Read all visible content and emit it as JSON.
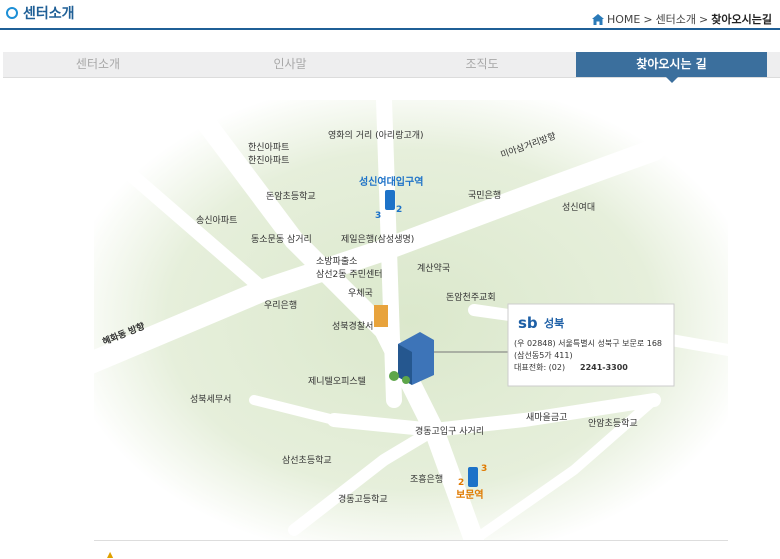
{
  "header": {
    "title": "센터소개"
  },
  "breadcrumb": {
    "home": "HOME",
    "sep1": ">",
    "level1": "센터소개",
    "sep2": ">",
    "current": "찾아오시는길"
  },
  "tabs": [
    {
      "label": "센터소개"
    },
    {
      "label": "인사말"
    },
    {
      "label": "조직도"
    },
    {
      "label": "찾아오시는 길"
    }
  ],
  "map": {
    "roads": {
      "yeonhwa": "영화의 거리\n(아리랑고개)",
      "miasamgeori": "미아삼거리방향",
      "hyehwa": "혜화동 방향"
    },
    "stations": {
      "sungshin": "성신여대입구역",
      "sungshin_lines": [
        "3",
        "2"
      ],
      "bomun": "보문역",
      "bomun_lines": [
        "2",
        "3"
      ]
    },
    "places": [
      "한신아파트",
      "한진아파트",
      "돈암초등학교",
      "국민은행",
      "성신여대",
      "송신아파트",
      "동소문동\n삼거리",
      "제일은행(삼성생명)",
      "소방파출소",
      "삼선2동 주민센터",
      "계산약국",
      "우체국",
      "돈암천주교회",
      "우리은행",
      "성북경찰서",
      "제니텔오피스텔",
      "성북세무서",
      "새마을금고",
      "안암초등학교",
      "경동고입구 사거리",
      "삼선초등학교",
      "조흥은행",
      "경동고등학교"
    ],
    "office": {
      "brand": "sb",
      "district": "성북",
      "address": "(우 02848) 서울특별시 성북구 보문로 168",
      "address2": "(삼선동5가 411)",
      "phone_label": "대표전화: (02)",
      "phone": "2241-3300"
    },
    "colors": {
      "station_blue": "#1d72c8",
      "station_orange": "#e07a00",
      "brand_blue": "#1d5fa6"
    }
  },
  "icons": {
    "home": "home-icon",
    "bullet": "small-flag-icon"
  }
}
